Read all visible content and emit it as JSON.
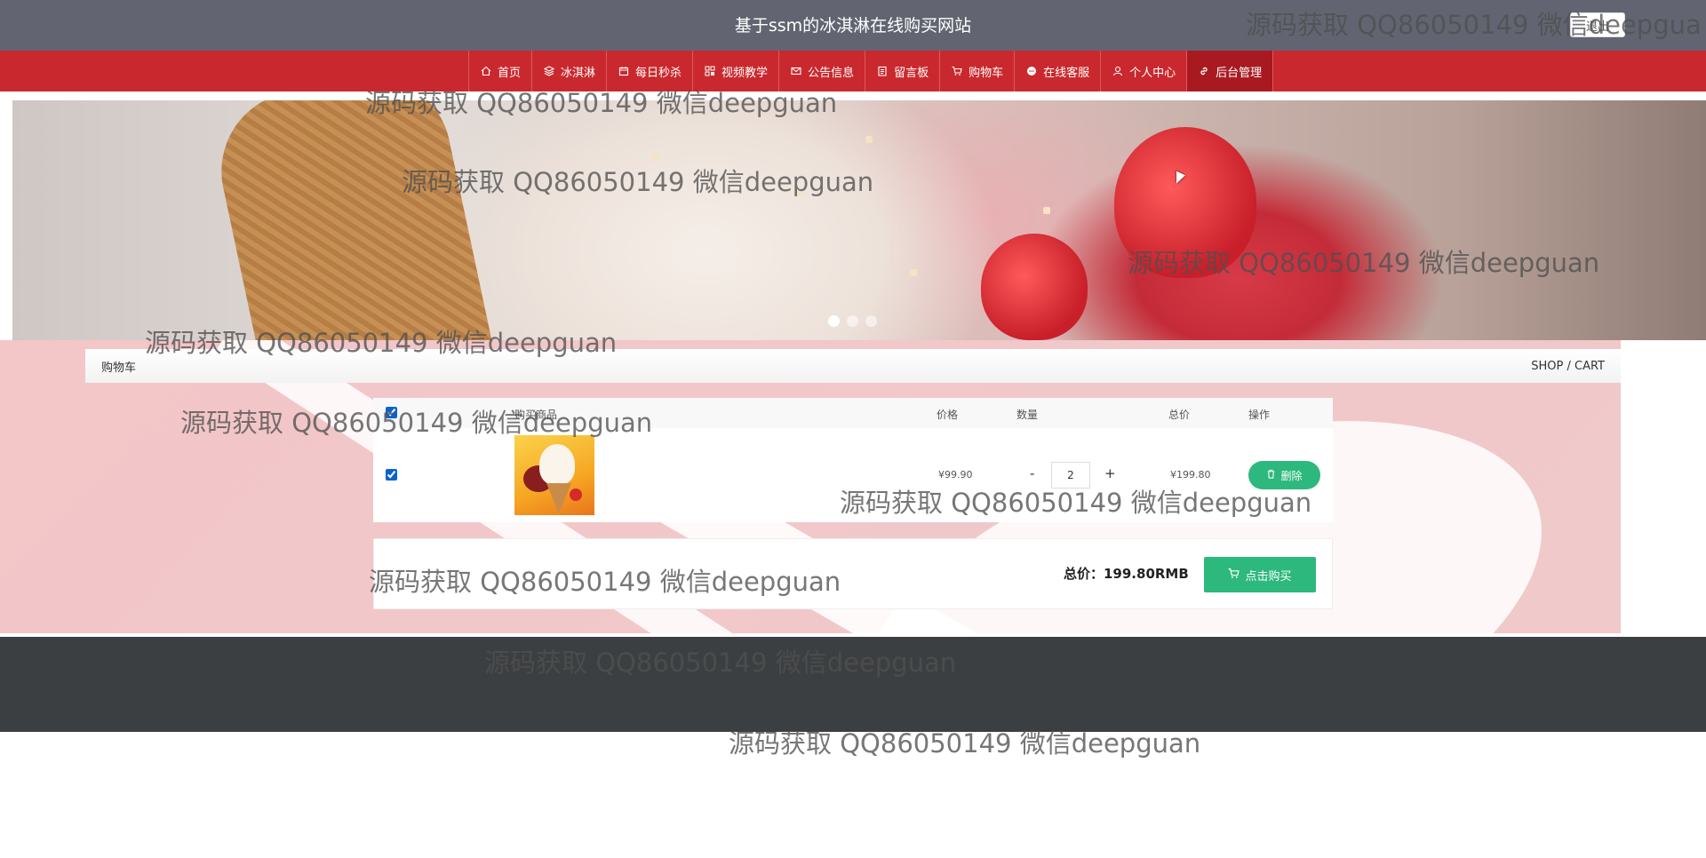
{
  "header": {
    "title": "基于ssm的冰淇淋在线购买网站",
    "logout_label": "退出"
  },
  "nav": {
    "items": [
      {
        "label": "首页",
        "icon": "home-icon"
      },
      {
        "label": "冰淇淋",
        "icon": "layers-icon"
      },
      {
        "label": "每日秒杀",
        "icon": "calendar-icon"
      },
      {
        "label": "视频教学",
        "icon": "apps-icon"
      },
      {
        "label": "公告信息",
        "icon": "mail-icon"
      },
      {
        "label": "留言板",
        "icon": "clipboard-icon"
      },
      {
        "label": "购物车",
        "icon": "cart-icon"
      },
      {
        "label": "在线客服",
        "icon": "chat-icon"
      },
      {
        "label": "个人中心",
        "icon": "user-icon"
      },
      {
        "label": "后台管理",
        "icon": "link-icon"
      }
    ],
    "active_index": 9
  },
  "banner": {
    "slide_count": 3,
    "active_slide": 0
  },
  "breadcrumb": {
    "left": "购物车",
    "right": "SHOP / CART"
  },
  "cart": {
    "columns": {
      "product": "购买商品",
      "price": "价格",
      "quantity": "数量",
      "total": "总价",
      "action": "操作"
    },
    "items": [
      {
        "price": "¥99.90",
        "quantity": "2",
        "total": "¥199.80",
        "checked": true
      }
    ],
    "delete_label": "删除",
    "minus": "-",
    "plus": "+",
    "total_label": "总价：199.80RMB",
    "buy_label": "点击购买"
  },
  "watermark": "源码获取 QQ86050149 微信deepguan",
  "watermark_partial": "源码获取 QQ86050149 微信deepgua",
  "colors": {
    "topbar": "#626571",
    "nav": "#c9292e",
    "nav_active": "#a81a20",
    "accent_green": "#2db87d",
    "footer": "#3c3f42",
    "content_bg": "#f3c6c8"
  }
}
